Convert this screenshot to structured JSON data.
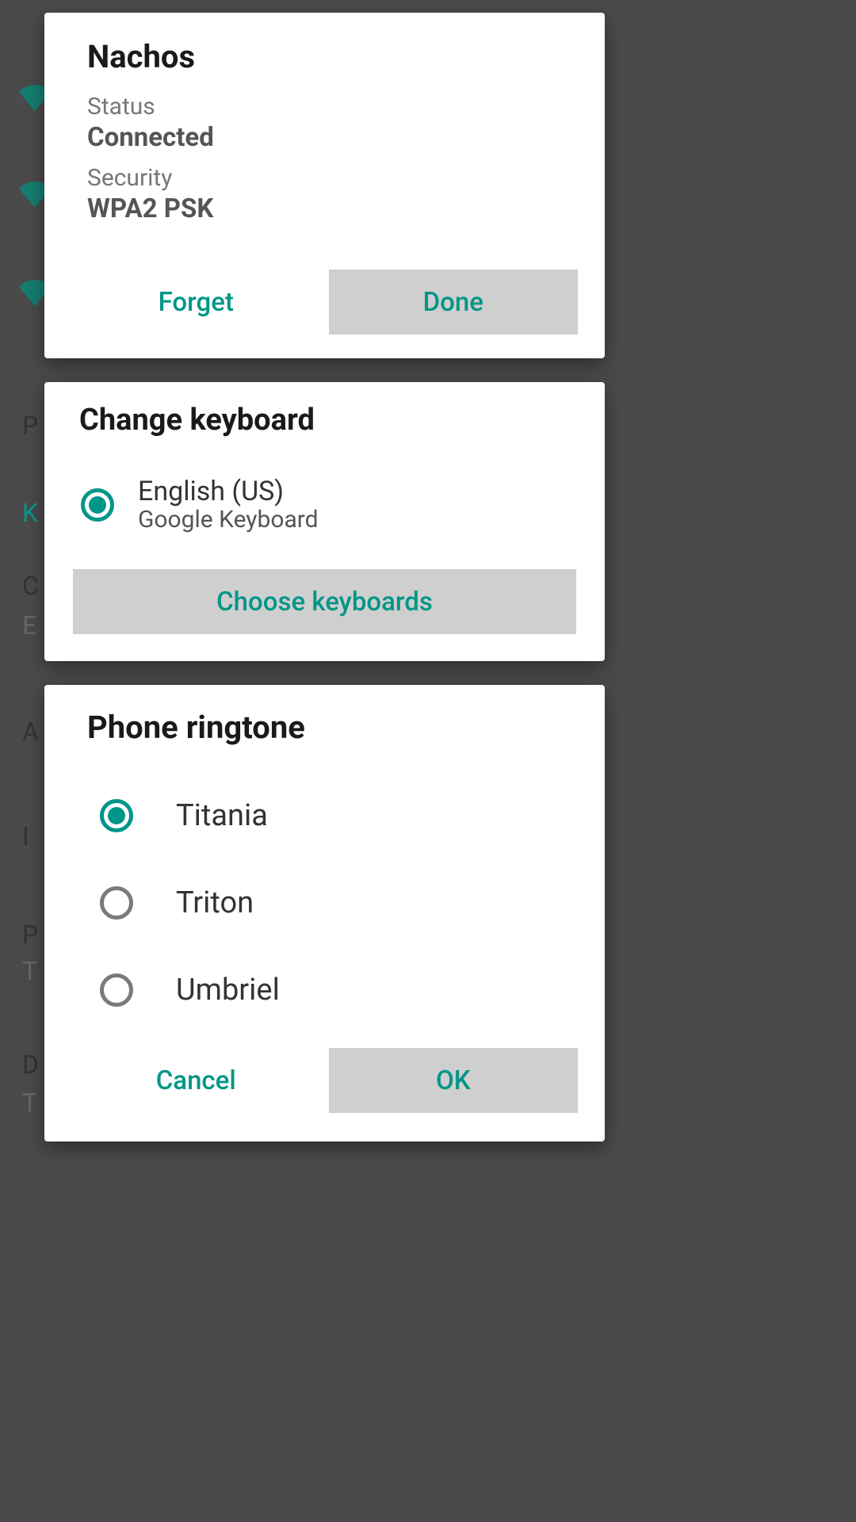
{
  "bg": {
    "items": [
      "P",
      "K",
      "C",
      "E",
      "A",
      "I",
      "P",
      "T",
      "D",
      "T"
    ]
  },
  "wifi_dialog": {
    "title": "Nachos",
    "status_label": "Status",
    "status_value": "Connected",
    "security_label": "Security",
    "security_value": "WPA2 PSK",
    "forget_label": "Forget",
    "done_label": "Done"
  },
  "keyboard_dialog": {
    "title": "Change keyboard",
    "option_primary": "English (US)",
    "option_secondary": "Google Keyboard",
    "choose_label": "Choose keyboards"
  },
  "ringtone_dialog": {
    "title": "Phone ringtone",
    "options": [
      "Titania",
      "Triton",
      "Umbriel"
    ],
    "selected_index": 0,
    "cancel_label": "Cancel",
    "ok_label": "OK"
  }
}
